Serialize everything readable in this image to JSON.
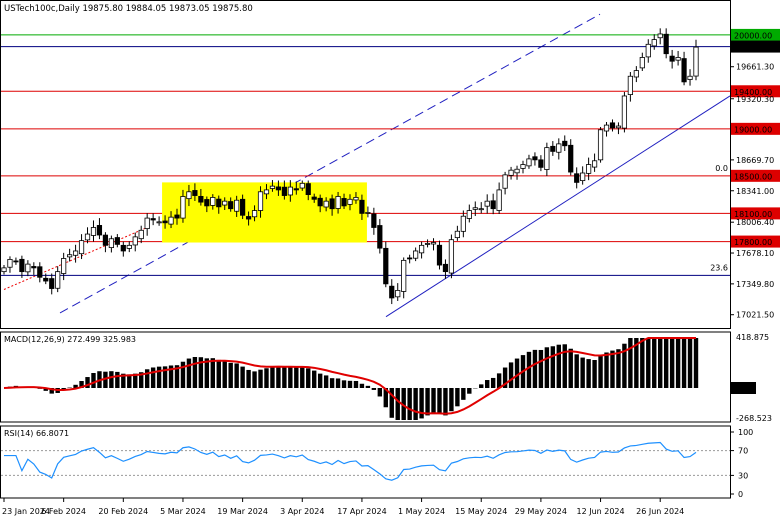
{
  "chart_data": [
    {
      "type": "candlestick",
      "title": "USTech100c,Daily  19875.80 19884.05 19873.05 19875.80",
      "price_ticks": [
        "19661.30",
        "19320.30",
        "18669.70",
        "18341.00",
        "18006.40",
        "17678.10",
        "17349.80",
        "17021.50"
      ],
      "horizontal_levels": [
        {
          "label": "20000.00",
          "value": 20000,
          "color": "#00aa00"
        },
        {
          "label": "19875.80",
          "value": 19875.8,
          "color": "#000080"
        },
        {
          "label": "19400.00",
          "value": 19400,
          "color": "#dd0000"
        },
        {
          "label": "19000.00",
          "value": 19000,
          "color": "#dd0000"
        },
        {
          "label": "18500.00",
          "value": 18500,
          "color": "#dd0000"
        },
        {
          "label": "18100.00",
          "value": 18100,
          "color": "#dd0000"
        },
        {
          "label": "17800.00",
          "value": 17800,
          "color": "#dd0000"
        },
        {
          "label": "",
          "value": 17440,
          "color": "#000080"
        }
      ],
      "fib_labels": [
        {
          "label": "0.0",
          "value": 18520
        },
        {
          "label": "23.6",
          "value": 17460
        }
      ],
      "x_ticks": [
        "23 Jan 2024",
        "6 Feb 2024",
        "20 Feb 2024",
        "5 Mar 2024",
        "19 Mar 2024",
        "3 Apr 2024",
        "17 Apr 2024",
        "1 May 2024",
        "15 May 2024",
        "29 May 2024",
        "12 Jun 2024",
        "26 Jun 2024"
      ],
      "ohlc_close": [
        17520,
        17610,
        17590,
        17480,
        17560,
        17520,
        17420,
        17380,
        17300,
        17480,
        17620,
        17660,
        17700,
        17810,
        17880,
        17950,
        17870,
        17760,
        17830,
        17770,
        17700,
        17760,
        17850,
        17920,
        18050,
        18030,
        18010,
        18000,
        18060,
        18050,
        18280,
        18330,
        18290,
        18220,
        18180,
        18270,
        18170,
        18230,
        18150,
        18240,
        18080,
        18040,
        18130,
        18330,
        18350,
        18390,
        18350,
        18290,
        18380,
        18350,
        18420,
        18300,
        18250,
        18180,
        18230,
        18150,
        18280,
        18180,
        18250,
        18270,
        18100,
        18110,
        17950,
        17730,
        17350,
        17200,
        17280,
        17600,
        17620,
        17700,
        17760,
        17780,
        17790,
        17550,
        17480,
        17820,
        17910,
        18070,
        18130,
        18160,
        18150,
        18230,
        18150,
        18350,
        18510,
        18560,
        18570,
        18620,
        18680,
        18670,
        18590,
        18800,
        18760,
        18840,
        18820,
        18540,
        18430,
        18530,
        18620,
        18660,
        18990,
        19040,
        19010,
        19030,
        19350,
        19560,
        19620,
        19760,
        19900,
        19950,
        20010,
        19800,
        19720,
        19760,
        19500,
        19560,
        19870
      ],
      "macd": {
        "label": "MACD(12,26,9) 272.499 325.983",
        "ticks": [
          "418.875",
          "0.00",
          "-268.523"
        ]
      },
      "rsi": {
        "label": "RSI(14) 66.8071",
        "ticks": [
          "100",
          "70",
          "30",
          "0"
        ]
      }
    }
  ]
}
